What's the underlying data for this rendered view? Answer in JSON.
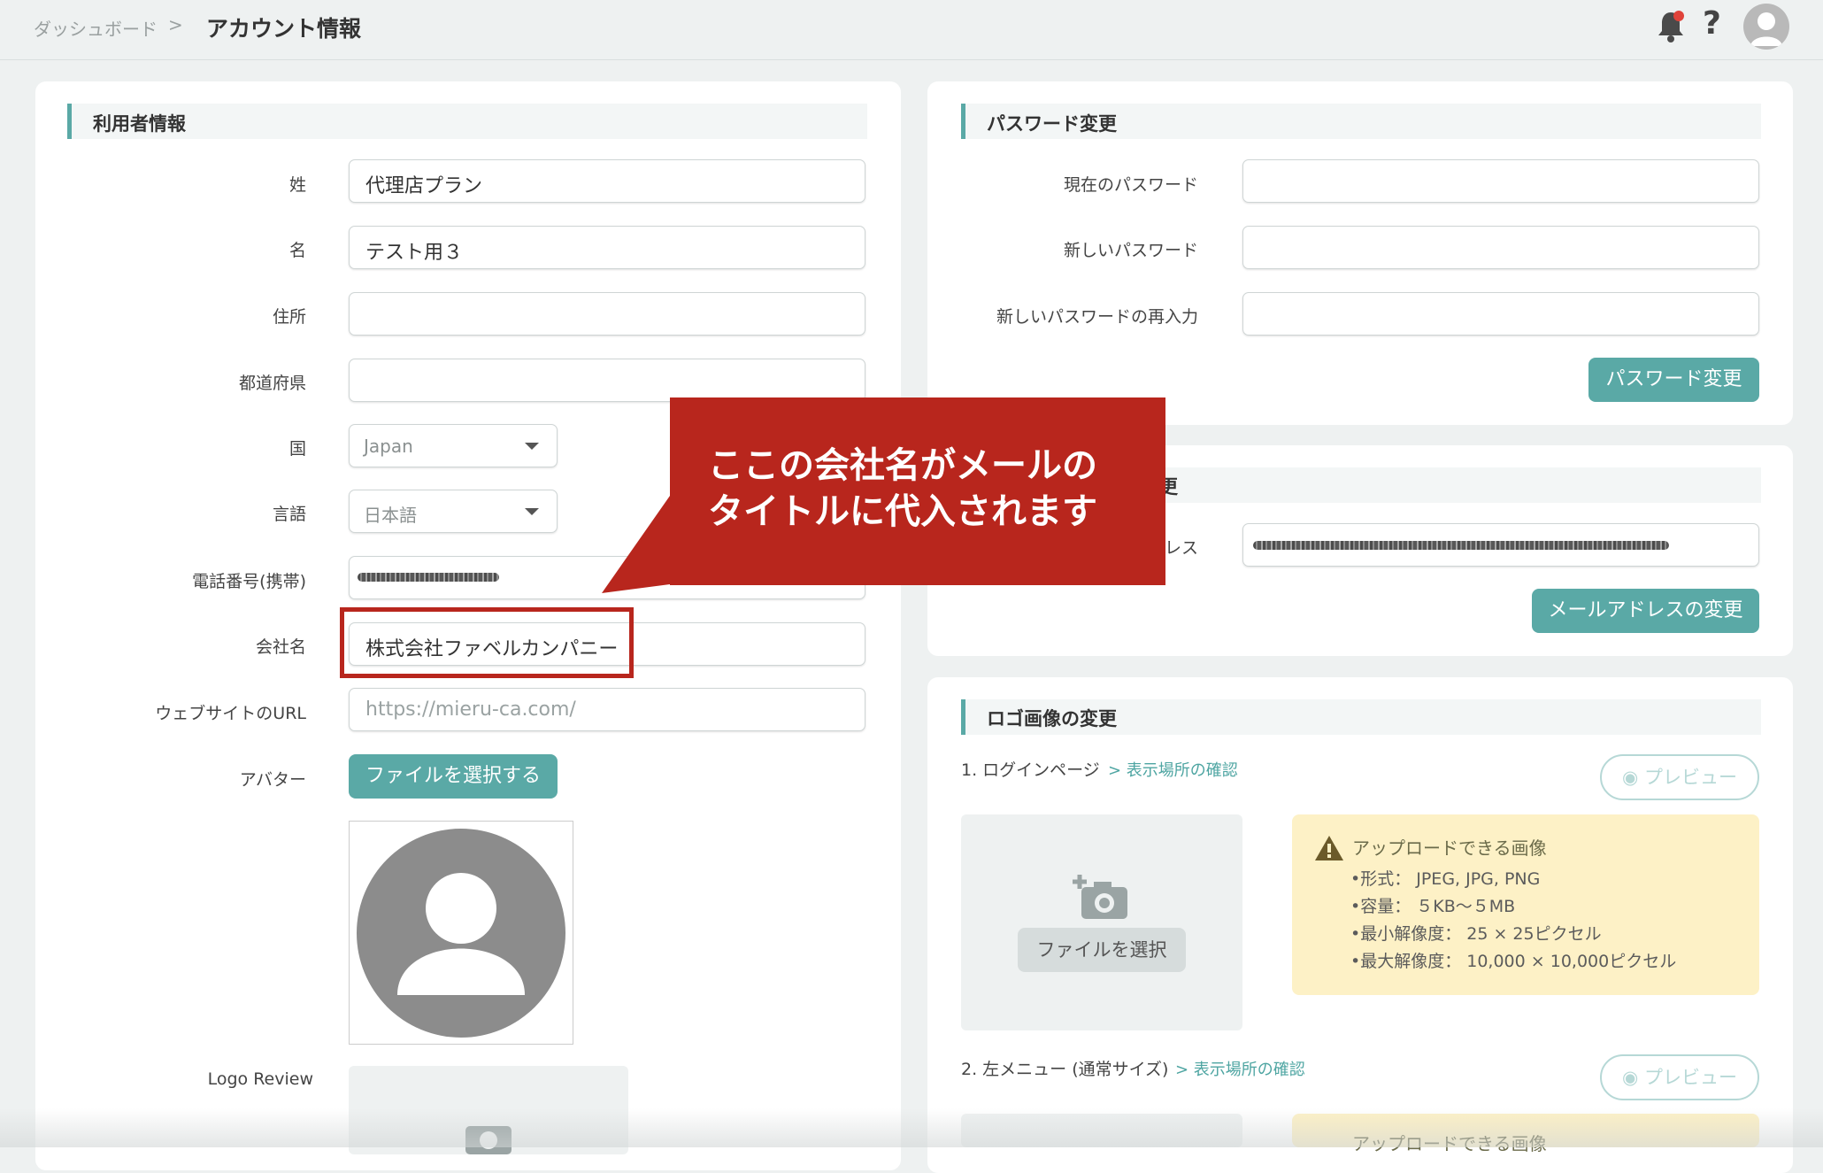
{
  "breadcrumb": {
    "home": "ダッシュボード",
    "separator": ">",
    "current": "アカウント情報"
  },
  "header": {
    "help_glyph": "?"
  },
  "user_info": {
    "title": "利用者情報",
    "last_name": {
      "label": "姓",
      "value": "代理店プラン"
    },
    "first_name": {
      "label": "名",
      "value": "テスト用３"
    },
    "address": {
      "label": "住所",
      "value": ""
    },
    "prefecture": {
      "label": "都道府県",
      "value": ""
    },
    "country": {
      "label": "国",
      "value": "Japan"
    },
    "language": {
      "label": "言語",
      "value": "日本語"
    },
    "phone": {
      "label": "電話番号(携帯)",
      "value": ""
    },
    "company": {
      "label": "会社名",
      "value": "株式会社ファベルカンパニー"
    },
    "website": {
      "label": "ウェブサイトのURL",
      "placeholder": "https://mieru-ca.com/"
    },
    "avatar": {
      "label": "アバター",
      "button": "ファイルを選択する"
    },
    "logo_review": {
      "label": "Logo Review"
    }
  },
  "password": {
    "title": "パスワード変更",
    "current_label": "現在のパスワード",
    "new_label": "新しいパスワード",
    "confirm_label": "新しいパスワードの再入力",
    "submit": "パスワード変更"
  },
  "email": {
    "title_visible": "更",
    "label_visible": "レス",
    "submit": "メールアドレスの変更"
  },
  "logo": {
    "title": "ロゴ画像の変更",
    "items": [
      {
        "label": "1. ログインページ",
        "link": "> 表示場所の確認",
        "preview": "プレビュー",
        "upload_button": "ファイルを選択"
      },
      {
        "label": "2. 左メニュー (通常サイズ)",
        "link": "> 表示場所の確認",
        "preview": "プレビュー"
      }
    ],
    "info": {
      "title": "アップロードできる画像",
      "lines": [
        "•形式： JPEG, JPG, PNG",
        "•容量： ５KB〜５MB",
        "•最小解像度： 25 × 25ピクセル",
        "•最大解像度： 10,000 × 10,000ピクセル"
      ]
    },
    "info2_title": "アップロードできる画像"
  },
  "callout": {
    "line1": "ここの会社名がメールの",
    "line2": "タイトルに代入されます",
    "color": "#b8261d"
  },
  "colors": {
    "accent": "#5aa9a6",
    "background": "#eef1f1",
    "warning_bg": "#fdf1c6",
    "notification": "#e0433a"
  },
  "icons": [
    "bell-icon",
    "help-icon",
    "user-avatar-icon",
    "caret-down-icon",
    "camera-plus-icon",
    "eye-icon",
    "warning-icon"
  ]
}
